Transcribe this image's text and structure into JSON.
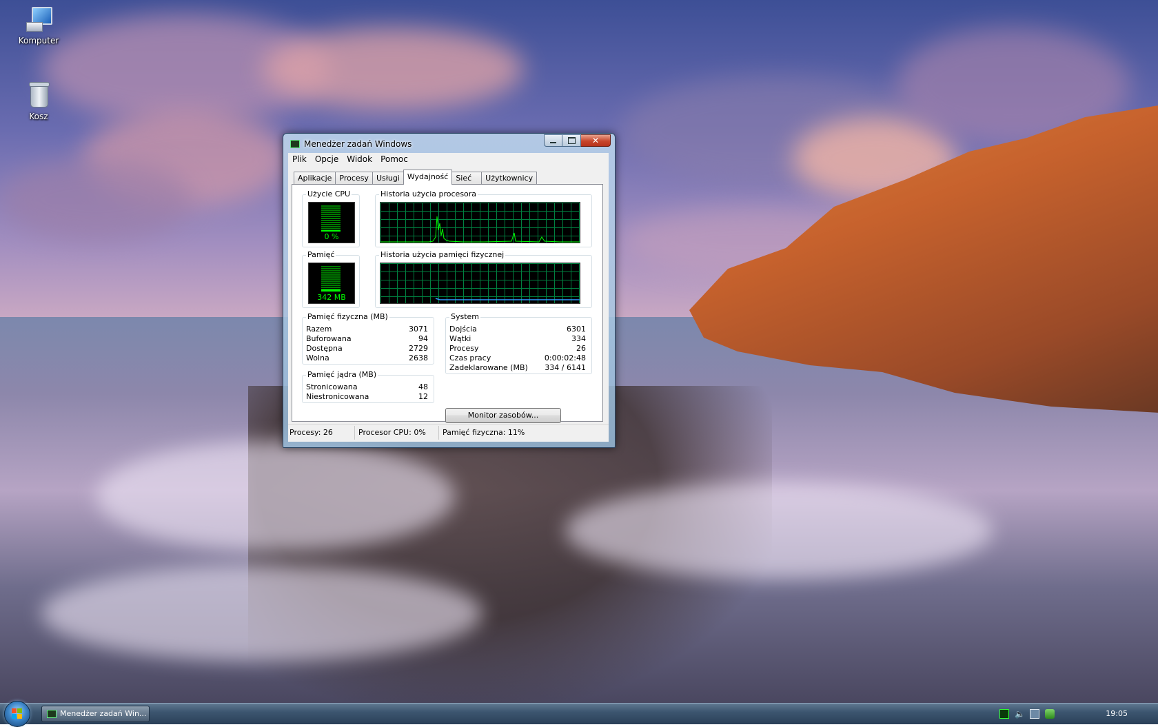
{
  "desktop": {
    "icons": [
      {
        "label": "Komputer",
        "icon": "computer-icon"
      },
      {
        "label": "Kosz",
        "icon": "recycle-bin-icon"
      }
    ]
  },
  "window": {
    "title": "Menedżer zadań Windows",
    "icon": "task-manager-icon",
    "menu": [
      "Plik",
      "Opcje",
      "Widok",
      "Pomoc"
    ],
    "tabs": [
      "Aplikacje",
      "Procesy",
      "Usługi",
      "Wydajność",
      "Sieć",
      "Użytkownicy"
    ],
    "active_tab": "Wydajność",
    "cpu": {
      "label": "Użycie CPU",
      "value": "0 %",
      "level": 0
    },
    "cpu_history": {
      "label": "Historia użycia procesora"
    },
    "memory": {
      "label": "Pamięć",
      "value": "342 MB",
      "level": 0.11
    },
    "memory_history": {
      "label": "Historia użycia pamięci fizycznej"
    },
    "physical_memory": {
      "title": "Pamięć fizyczna (MB)",
      "rows": [
        {
          "label": "Razem",
          "value": "3071"
        },
        {
          "label": "Buforowana",
          "value": "94"
        },
        {
          "label": "Dostępna",
          "value": "2729"
        },
        {
          "label": "Wolna",
          "value": "2638"
        }
      ]
    },
    "kernel_memory": {
      "title": "Pamięć jądra (MB)",
      "rows": [
        {
          "label": "Stronicowana",
          "value": "48"
        },
        {
          "label": "Niestronicowana",
          "value": "12"
        }
      ]
    },
    "system": {
      "title": "System",
      "rows": [
        {
          "label": "Dojścia",
          "value": "6301"
        },
        {
          "label": "Wątki",
          "value": "334"
        },
        {
          "label": "Procesy",
          "value": "26"
        },
        {
          "label": "Czas pracy",
          "value": "0:00:02:48"
        },
        {
          "label": "Zadeklarowane (MB)",
          "value": "334 / 6141"
        }
      ]
    },
    "resource_monitor_button": "Monitor zasobów...",
    "status": {
      "processes": "Procesy: 26",
      "cpu": "Procesor CPU: 0%",
      "memory": "Pamięć fizyczna: 11%"
    },
    "colors": {
      "graph_line": "#00ff00",
      "graph_grid": "#008040",
      "memory_line": "#3399ff"
    }
  },
  "taskbar": {
    "start": "start-orb-icon",
    "buttons": [
      {
        "label": "Menedżer zadań Win...",
        "icon": "task-manager-icon"
      }
    ],
    "tray_icons": [
      "task-manager-tray-icon",
      "volume-icon",
      "network-icon",
      "security-icon"
    ],
    "clock": "19:05"
  }
}
